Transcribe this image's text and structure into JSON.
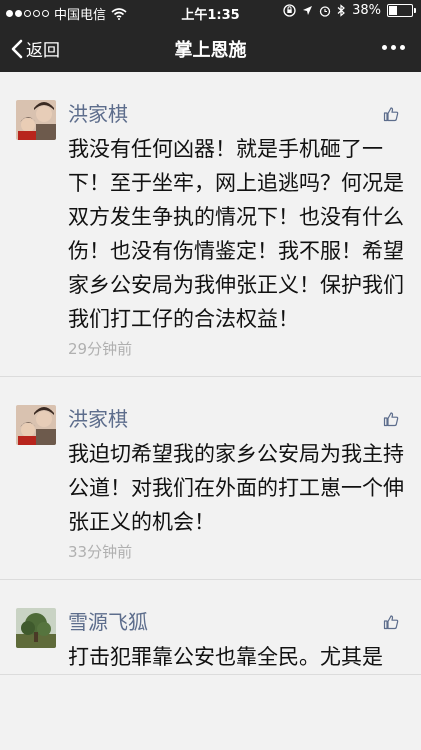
{
  "status_bar": {
    "carrier": "中国电信",
    "time": "上午1:35",
    "battery": "38%",
    "battery_level": 0.38
  },
  "nav": {
    "back_label": "返回",
    "title": "掌上恩施"
  },
  "comments": [
    {
      "name": "洪家棋",
      "text": "我没有任何凶器！就是手机砸了一下！至于坐牢，网上追逃吗？何况是双方发生争执的情况下！也没有什么伤！也没有伤情鉴定！我不服！希望家乡公安局为我伸张正义！保护我们我们打工仔的合法权益！",
      "time": "29分钟前"
    },
    {
      "name": "洪家棋",
      "text": "我迫切希望我的家乡公安局为我主持公道！对我们在外面的打工崽一个伸张正义的机会！",
      "time": "33分钟前"
    },
    {
      "name": "雪源飞狐",
      "text": "打击犯罪靠公安也靠全民。尤其是",
      "time": ""
    }
  ]
}
